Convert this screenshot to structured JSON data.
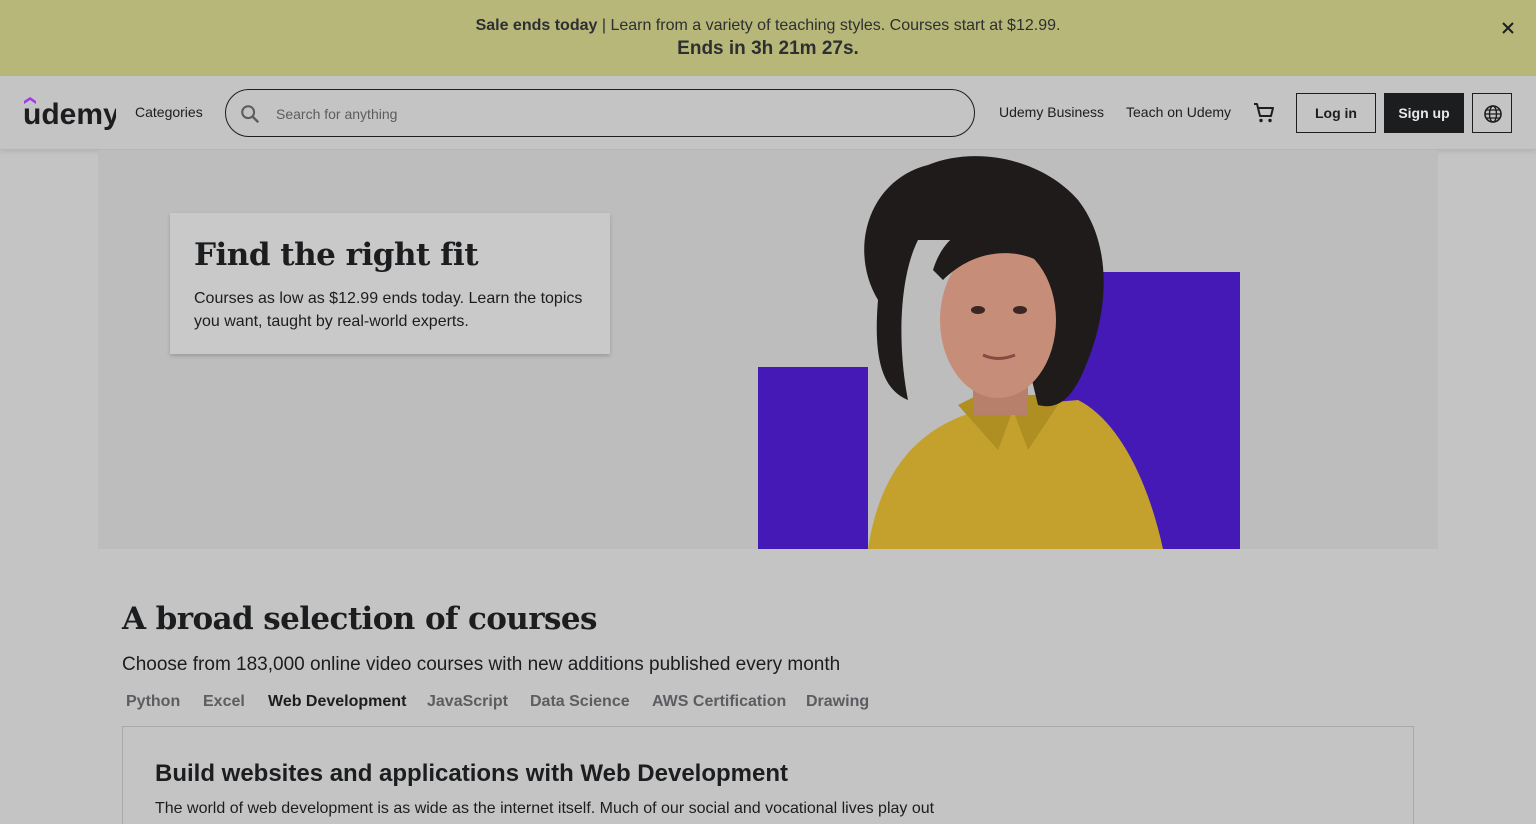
{
  "banner": {
    "sale_bold": "Sale ends today",
    "sale_text": " | Learn from a variety of teaching styles. Courses start at $12.99.",
    "countdown": "Ends in 3h 21m 27s.",
    "close_icon": "close-icon"
  },
  "header": {
    "logo_text": "ūdemy",
    "categories": "Categories",
    "search_placeholder": "Search for anything",
    "udemy_business": "Udemy Business",
    "teach": "Teach on Udemy",
    "cart_icon": "cart-icon",
    "login": "Log in",
    "signup": "Sign up",
    "globe_icon": "globe-icon"
  },
  "hero": {
    "title": "Find the right fit",
    "subtitle": "Courses as low as $12.99 ends today. Learn the topics you want, taught by real-world experts.",
    "accent_color": "#4419b5"
  },
  "courses": {
    "title": "A broad selection of courses",
    "subtitle": "Choose from 183,000 online video courses with new additions published every month",
    "tabs": [
      "Python",
      "Excel",
      "Web Development",
      "JavaScript",
      "Data Science",
      "AWS Certification",
      "Drawing"
    ],
    "active_tab": "Web Development",
    "panel_title": "Build websites and applications with Web Development",
    "panel_text": "The world of web development is as wide as the internet itself. Much of our social and vocational lives play out on the internet, which prompts new industries aimed at creating, managing, and debugging the websites and"
  }
}
